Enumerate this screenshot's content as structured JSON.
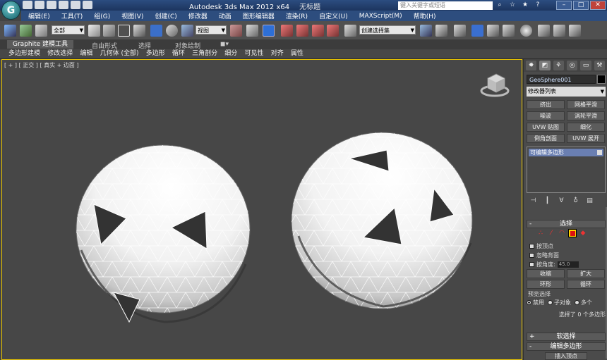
{
  "app": {
    "title": "Autodesk 3ds Max  2012 x64",
    "document": "无标题",
    "search_placeholder": "键入关键字或短语"
  },
  "menu": [
    "编辑(E)",
    "工具(T)",
    "组(G)",
    "视图(V)",
    "创建(C)",
    "修改器",
    "动画",
    "图形编辑器",
    "渲染(R)",
    "自定义(U)",
    "MAXScript(M)",
    "帮助(H)"
  ],
  "toolbar": {
    "filter_label": "全部",
    "view_label": "视图",
    "selection_set_label": "创建选择集"
  },
  "ribbon": {
    "tabs": [
      "Graphite 建模工具",
      "自由形式",
      "选择",
      "对象绘制"
    ],
    "sub_items": [
      "多边形建模",
      "修改选择",
      "编辑",
      "几何体 (全部)",
      "多边形",
      "循环",
      "三角剖分",
      "细分",
      "可见性",
      "对齐",
      "属性"
    ]
  },
  "viewport": {
    "label": "[ + ] [ 正交 ] [ 真实 + 边面 ]"
  },
  "command_panel": {
    "tab_icons": [
      "create-tab-icon",
      "modify-tab-icon",
      "hierarchy-tab-icon",
      "motion-tab-icon",
      "display-tab-icon",
      "utilities-tab-icon"
    ],
    "object_name": "GeoSphere001",
    "object_color": "#000000",
    "modifier_list": "修改器列表",
    "modifier_buttons": [
      "挤出",
      "网格平滑",
      "噪波",
      "涡轮平滑",
      "UVW 贴图",
      "细化",
      "倒角剖面",
      "UVW 展开"
    ],
    "stack": [
      "可编辑多边形"
    ],
    "selection_rollout": {
      "title": "选择",
      "by_vertex": "按顶点",
      "ignore_backfacing": "忽略背面",
      "by_angle": "按角度:",
      "angle_value": "45.0",
      "shrink": "收缩",
      "grow": "扩大",
      "ring": "环形",
      "loop": "循环",
      "preview_label": "预览选择",
      "preview_disabled": "禁用",
      "preview_subobject": "子对象",
      "preview_multi": "多个",
      "status": "选择了 0 个多边形"
    },
    "soft_selection": "软选择",
    "edit_polygons": "编辑多边形",
    "insert_vertex": "插入顶点"
  }
}
